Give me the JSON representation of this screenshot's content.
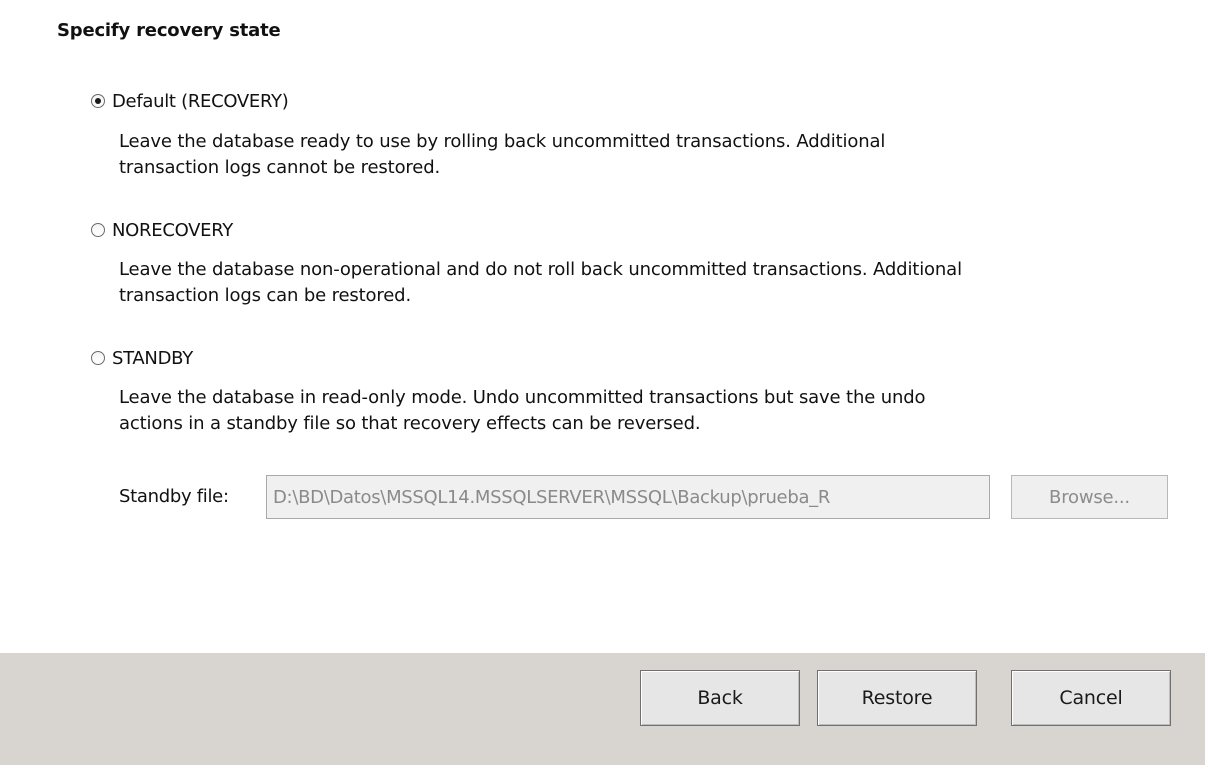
{
  "section": {
    "title": "Specify recovery state"
  },
  "options": [
    {
      "label": "Default (RECOVERY)",
      "selected": true,
      "description_line1": "Leave the database ready to use by rolling back uncommitted transactions. Additional",
      "description_line2": "transaction logs cannot be restored."
    },
    {
      "label": "NORECOVERY",
      "selected": false,
      "description_line1": "Leave the database non-operational and do not roll back uncommitted transactions. Additional",
      "description_line2": "transaction logs can be restored."
    },
    {
      "label": "STANDBY",
      "selected": false,
      "description_line1": "Leave the database in read-only mode. Undo uncommitted transactions but save the undo",
      "description_line2": "actions in a standby file so that recovery effects can be reversed."
    }
  ],
  "standby": {
    "label": "Standby file:",
    "value": "D:\\BD\\Datos\\MSSQL14.MSSQLSERVER\\MSSQL\\Backup\\prueba_R",
    "browse_label": "Browse...",
    "enabled": false
  },
  "footer": {
    "back_label": "Back",
    "restore_label": "Restore",
    "cancel_label": "Cancel"
  },
  "colors": {
    "footer_bg": "#d8d5d1",
    "disabled_text": "#8a8a8a"
  }
}
